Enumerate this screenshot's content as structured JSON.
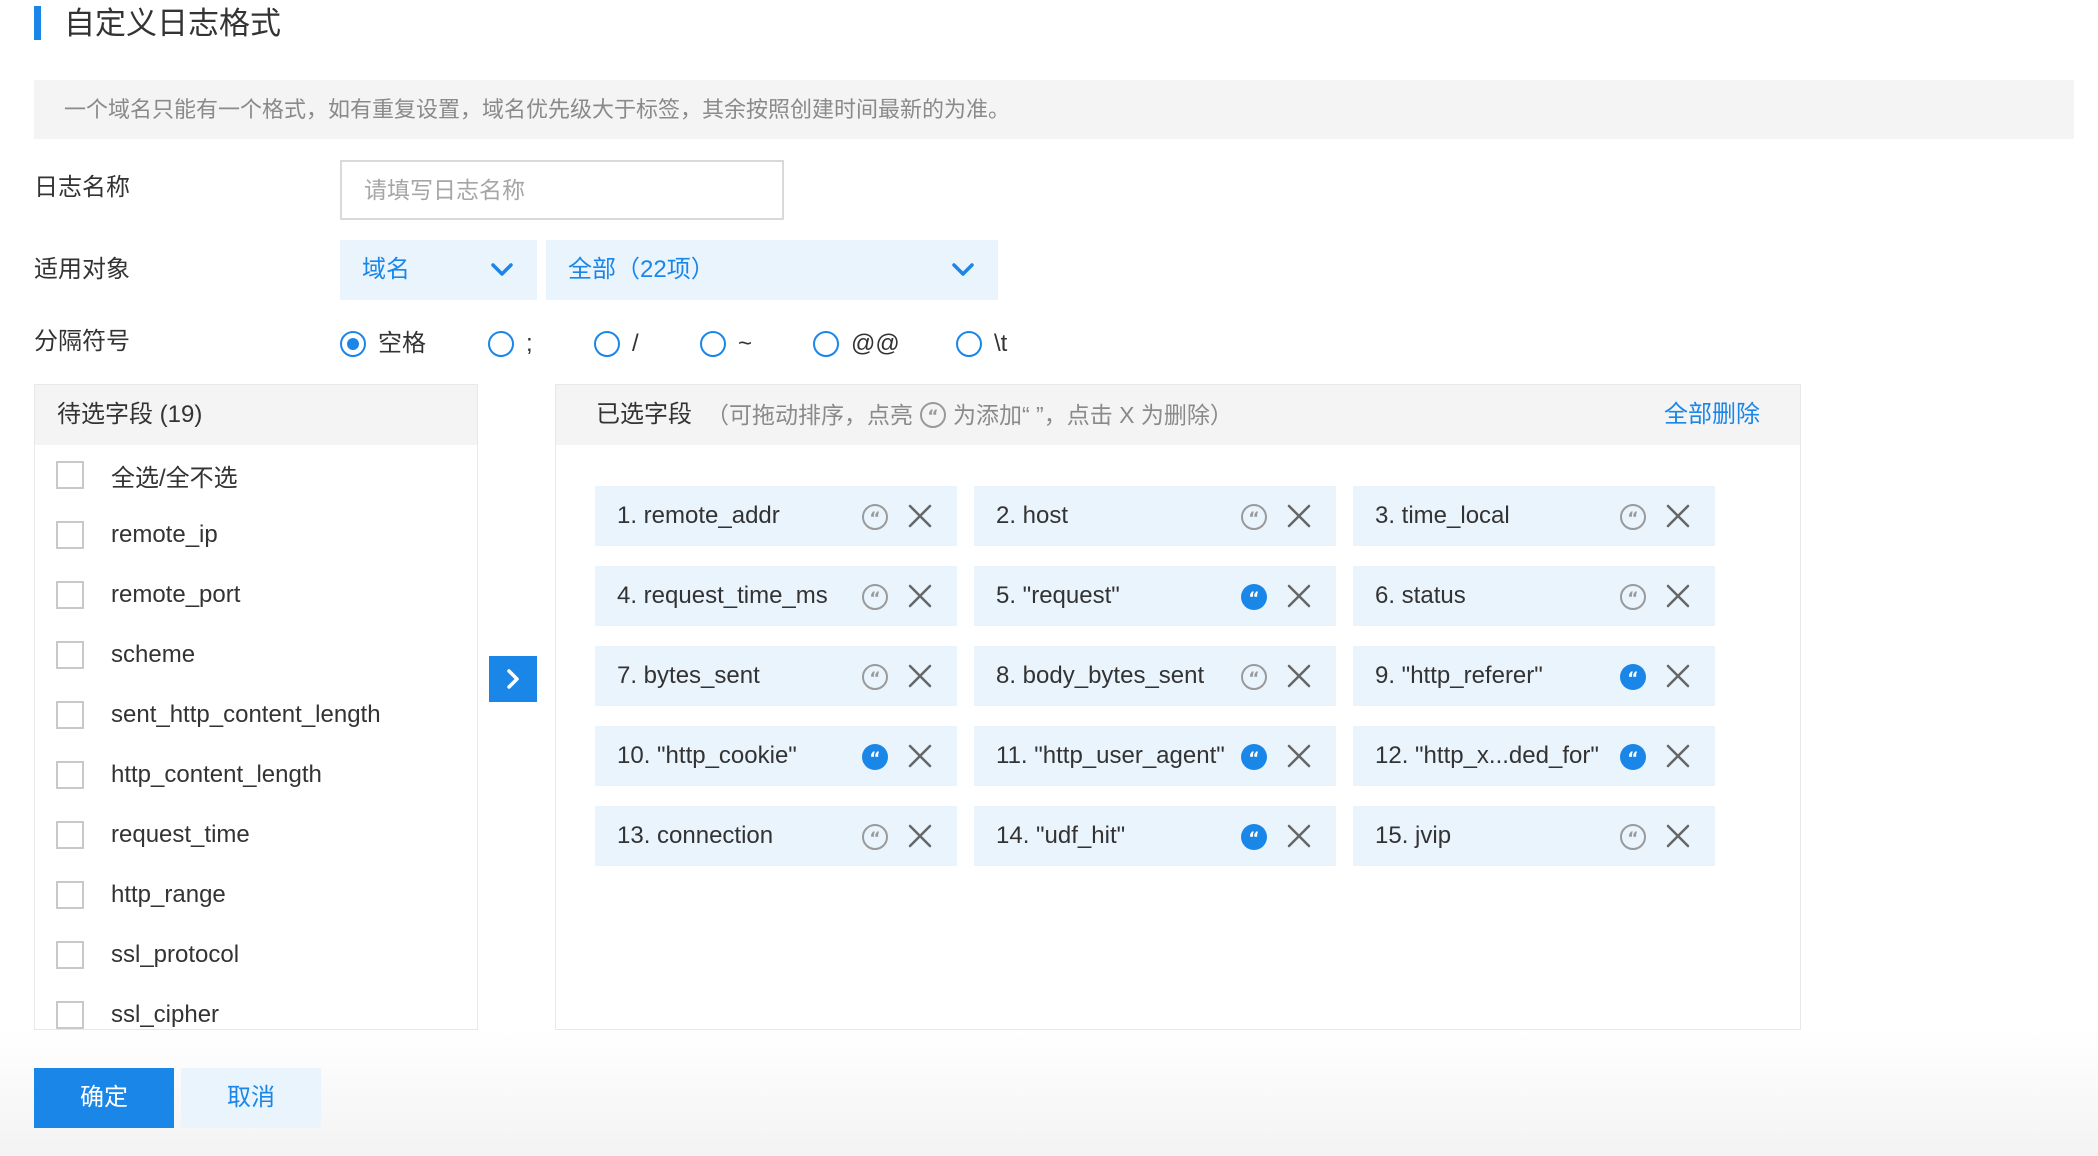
{
  "page": {
    "title": "自定义日志格式",
    "notice": "一个域名只能有一个格式，如有重复设置，域名优先级大于标签，其余按照创建时间最新的为准。"
  },
  "form": {
    "log_name_label": "日志名称",
    "log_name_placeholder": "请填写日志名称",
    "log_name_value": "",
    "target_label": "适用对象",
    "target_type_value": "域名",
    "target_scope_value": "全部（22项）",
    "separator_label": "分隔符号",
    "separators": [
      {
        "label": "空格",
        "checked": true
      },
      {
        "label": ";",
        "checked": false
      },
      {
        "label": "/",
        "checked": false
      },
      {
        "label": "~",
        "checked": false
      },
      {
        "label": "@@",
        "checked": false
      },
      {
        "label": "\\t",
        "checked": false
      }
    ]
  },
  "candidates": {
    "header": "待选字段 (19)",
    "select_all_label": "全选/全不选",
    "items": [
      "remote_ip",
      "remote_port",
      "scheme",
      "sent_http_content_length",
      "http_content_length",
      "request_time",
      "http_range",
      "ssl_protocol",
      "ssl_cipher"
    ]
  },
  "selected": {
    "title": "已选字段",
    "hint_prefix": "（可拖动排序，点亮",
    "hint_suffix": "为添加“ ”，点击 X 为删除）",
    "clear_all_label": "全部删除",
    "fields": [
      {
        "label": "1. remote_addr",
        "quoted": false
      },
      {
        "label": "2. host",
        "quoted": false
      },
      {
        "label": "3. time_local",
        "quoted": false
      },
      {
        "label": "4. request_time_ms",
        "quoted": false
      },
      {
        "label": "5. \"request\"",
        "quoted": true
      },
      {
        "label": "6. status",
        "quoted": false
      },
      {
        "label": "7. bytes_sent",
        "quoted": false
      },
      {
        "label": "8. body_bytes_sent",
        "quoted": false
      },
      {
        "label": "9. \"http_referer\"",
        "quoted": true
      },
      {
        "label": "10. \"http_cookie\"",
        "quoted": true
      },
      {
        "label": "11. \"http_user_agent\"",
        "quoted": true
      },
      {
        "label": "12. \"http_x...ded_for\"",
        "quoted": true
      },
      {
        "label": "13. connection",
        "quoted": false
      },
      {
        "label": "14. \"udf_hit\"",
        "quoted": true
      },
      {
        "label": "15. jvip",
        "quoted": false
      }
    ]
  },
  "actions": {
    "confirm_label": "确定",
    "cancel_label": "取消"
  },
  "icons": {
    "quote_toggle": "quote-icon",
    "remove": "close-icon",
    "move_right": "chevron-right-icon",
    "dropdown": "chevron-down-icon"
  },
  "colors": {
    "accent": "#1a86e8",
    "chip_bg": "#eaf4fd",
    "panel_header_bg": "#f4f4f5"
  }
}
